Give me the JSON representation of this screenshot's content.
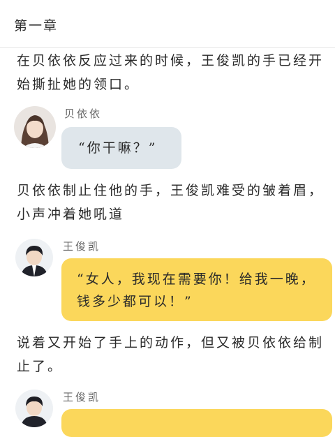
{
  "header": {
    "chapter_title": "第一章"
  },
  "story": {
    "p1": "在贝依依反应过来的时候，王俊凯的手已经开始撕扯她的领口。",
    "msg1": {
      "speaker": "贝依依",
      "text": "“你干嘛？”"
    },
    "p2": "贝依依制止住他的手，王俊凯难受的皱着眉，小声冲着她吼道",
    "msg2": {
      "speaker": "王俊凯",
      "text": "“女人，我现在需要你！给我一晚，钱多少都可以！”"
    },
    "p3": "说着又开始了手上的动作，但又被贝依依给制止了。",
    "msg3": {
      "speaker": "王俊凯"
    }
  },
  "colors": {
    "grey_bubble": "#dfe6eb",
    "yellow_bubble": "#fbd75b"
  },
  "icons": {
    "avatar_female": "avatar-female-icon",
    "avatar_male": "avatar-male-icon"
  }
}
